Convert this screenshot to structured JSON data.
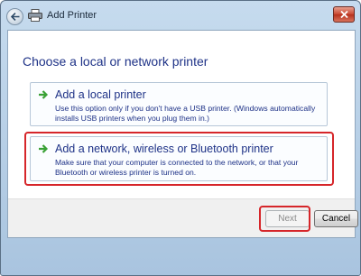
{
  "window": {
    "title": "Add Printer",
    "close_icon": "close-icon",
    "back_icon": "back-arrow-icon",
    "app_icon": "printer-icon"
  },
  "main": {
    "heading": "Choose a local or network printer",
    "options": [
      {
        "title": "Add a local printer",
        "description": "Use this option only if you don't have a USB printer. (Windows automatically installs USB printers when you plug them in.)",
        "icon": "green-arrow-icon"
      },
      {
        "title": "Add a network, wireless or Bluetooth printer",
        "description": "Make sure that your computer is connected to the network, or that your Bluetooth or wireless printer is turned on.",
        "icon": "green-arrow-icon"
      }
    ]
  },
  "footer": {
    "next_label": "Next",
    "cancel_label": "Cancel"
  },
  "colors": {
    "highlight": "#d6262a",
    "link_text": "#1e3287"
  }
}
